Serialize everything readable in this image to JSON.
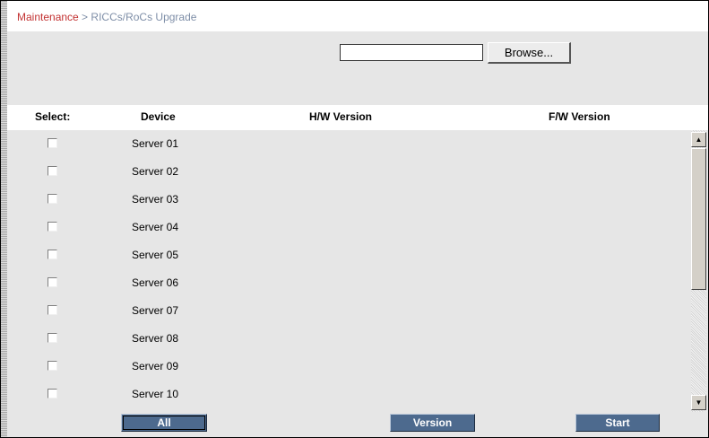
{
  "breadcrumb": {
    "parent": "Maintenance",
    "separator": " > ",
    "current": "RICCs/RoCs Upgrade"
  },
  "upload": {
    "file_value": "",
    "browse_label": "Browse..."
  },
  "table": {
    "columns": {
      "select": "Select:",
      "device": "Device",
      "hw": "H/W Version",
      "fw": "F/W Version"
    },
    "rows": [
      {
        "device": "Server 01",
        "hw": "",
        "fw": "",
        "checked": false
      },
      {
        "device": "Server 02",
        "hw": "",
        "fw": "",
        "checked": false
      },
      {
        "device": "Server 03",
        "hw": "",
        "fw": "",
        "checked": false
      },
      {
        "device": "Server 04",
        "hw": "",
        "fw": "",
        "checked": false
      },
      {
        "device": "Server 05",
        "hw": "",
        "fw": "",
        "checked": false
      },
      {
        "device": "Server 06",
        "hw": "",
        "fw": "",
        "checked": false
      },
      {
        "device": "Server 07",
        "hw": "",
        "fw": "",
        "checked": false
      },
      {
        "device": "Server 08",
        "hw": "",
        "fw": "",
        "checked": false
      },
      {
        "device": "Server 09",
        "hw": "",
        "fw": "",
        "checked": false
      },
      {
        "device": "Server 10",
        "hw": "",
        "fw": "",
        "checked": false
      }
    ]
  },
  "actions": {
    "all_label": "All",
    "version_label": "Version",
    "start_label": "Start"
  },
  "icons": {
    "scroll_up": "scroll-up-arrow-icon",
    "scroll_down": "scroll-down-arrow-icon"
  },
  "colors": {
    "breadcrumb_link": "#c33333",
    "breadcrumb_current": "#7f8fa8",
    "panel_background": "#e6e6e6",
    "action_button": "#4d6a8e"
  }
}
